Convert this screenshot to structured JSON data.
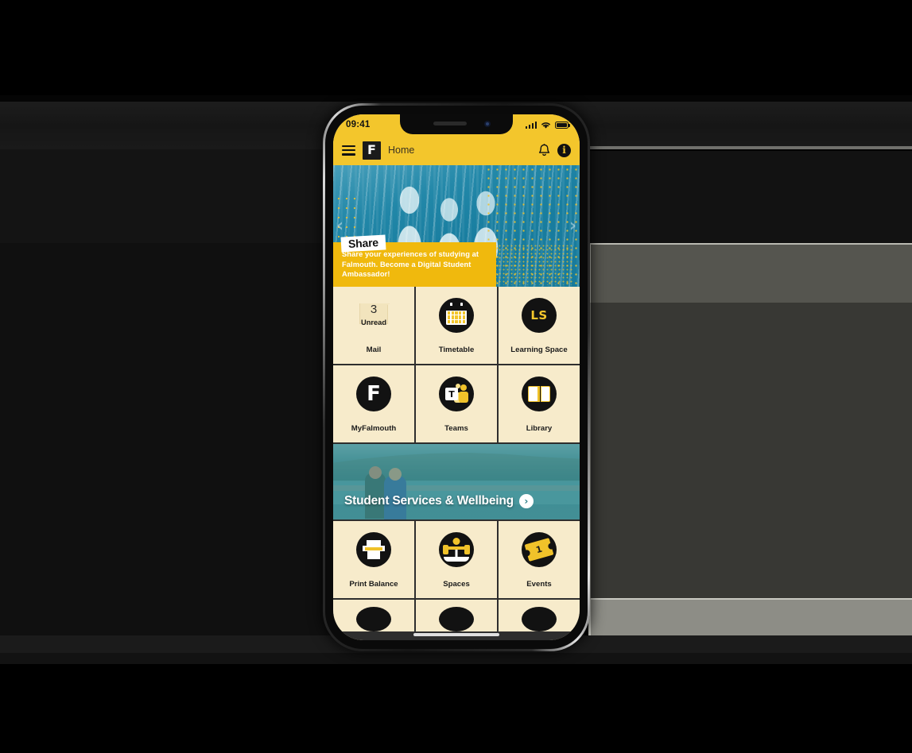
{
  "phone": {
    "status_bar": {
      "time": "09:41",
      "signal_icon": "cellular-bars-icon",
      "wifi_icon": "wifi-icon",
      "battery_icon": "battery-full-icon"
    },
    "header": {
      "menu_icon": "hamburger-menu-icon",
      "logo_letter": "F",
      "title": "Home",
      "bell_icon": "notification-bell-icon",
      "info_icon": "info-icon",
      "info_glyph": "i"
    },
    "hero": {
      "tag": "Share",
      "body": "Share your experiences of studying at Falmouth. Become a Digital Student Ambassador!",
      "prev_icon": "chevron-left-icon",
      "next_icon": "chevron-right-icon",
      "prev_glyph": "‹",
      "next_glyph": "›"
    },
    "tiles": [
      {
        "label": "Mail",
        "icon": "envelope-icon",
        "badge": "3",
        "badge_sub": "Unread"
      },
      {
        "label": "Timetable",
        "icon": "calendar-icon"
      },
      {
        "label": "Learning Space",
        "icon": "learning-space-icon",
        "glyph": "LS"
      },
      {
        "label": "MyFalmouth",
        "icon": "falmouth-f-icon",
        "glyph": "F"
      },
      {
        "label": "Teams",
        "icon": "microsoft-teams-icon",
        "glyph": "T"
      },
      {
        "label": "Library",
        "icon": "open-book-icon"
      },
      {
        "label": "Print Balance",
        "icon": "printer-icon"
      },
      {
        "label": "Spaces",
        "icon": "desk-person-icon"
      },
      {
        "label": "Events",
        "icon": "ticket-icon",
        "glyph": "1"
      }
    ],
    "services_banner": {
      "title": "Student Services & Wellbeing",
      "arrow_icon": "chevron-right-circle-icon",
      "arrow_glyph": "›"
    },
    "home_indicator": "home-indicator"
  },
  "colors": {
    "brand_yellow": "#f3c62c",
    "banner_yellow": "#f0b90d",
    "tile_cream": "#f7ebcb",
    "icon_black": "#121212",
    "hero_teal": "#1a7fa0",
    "services_teal": "#4f8f90"
  }
}
